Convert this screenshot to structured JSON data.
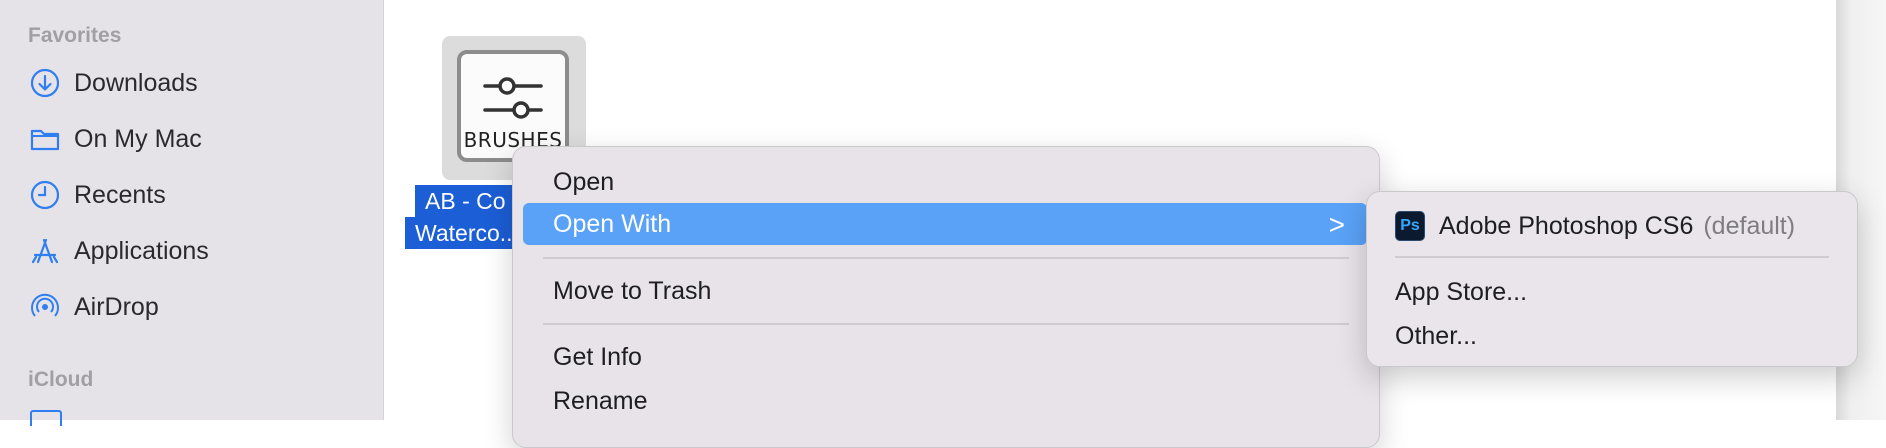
{
  "sidebar": {
    "favorites_title": "Favorites",
    "icloud_title": "iCloud",
    "items": [
      {
        "label": "Downloads",
        "icon": "download-circle-icon"
      },
      {
        "label": "On My Mac",
        "icon": "folder-icon"
      },
      {
        "label": "Recents",
        "icon": "clock-icon"
      },
      {
        "label": "Applications",
        "icon": "applications-icon"
      },
      {
        "label": "AirDrop",
        "icon": "airdrop-icon"
      }
    ]
  },
  "file": {
    "badge_text": "BRUSHES",
    "name_line1": "AB - Co",
    "name_line2": "Waterco..."
  },
  "context_menu": {
    "open": "Open",
    "open_with": "Open With",
    "chevron": ">",
    "move_to_trash": "Move to Trash",
    "get_info": "Get Info",
    "rename": "Rename"
  },
  "submenu": {
    "app_name": "Adobe Photoshop CS6",
    "app_tag": "(default)",
    "app_icon_text": "Ps",
    "app_store": "App Store...",
    "other": "Other..."
  },
  "colors": {
    "accent": "#1c5ed6",
    "highlight": "#5aa2f7",
    "sidebar_bg": "#e6e3e8",
    "icon_blue": "#2f7ff0"
  }
}
